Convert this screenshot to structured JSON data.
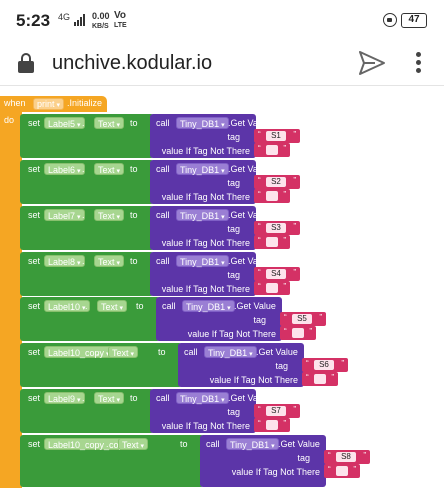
{
  "status_bar": {
    "time": "5:23",
    "signal": "4G",
    "speed_value": "0.00",
    "speed_unit": "KB/S",
    "carrier": "Vo",
    "carrier2": "LTE",
    "battery": "47"
  },
  "browser": {
    "url": "unchive.kodular.io"
  },
  "event": {
    "when_label": "when",
    "component": "print",
    "event_name": ".Initialize",
    "do_label": "do"
  },
  "blocks": [
    {
      "label": "Label5",
      "prop": "Text",
      "db": "Tiny_DB1",
      "method": ".Get Value",
      "tag": "S1"
    },
    {
      "label": "Label6",
      "prop": "Text",
      "db": "Tiny_DB1",
      "method": ".Get Value",
      "tag": "S2"
    },
    {
      "label": "Label7",
      "prop": "Text",
      "db": "Tiny_DB1",
      "method": ".Get Value",
      "tag": "S3"
    },
    {
      "label": "Label8",
      "prop": "Text",
      "db": "Tiny_DB1",
      "method": ".Get Value",
      "tag": "S4"
    },
    {
      "label": "Label10",
      "prop": "Text",
      "db": "Tiny_DB1",
      "method": ".Get Value",
      "tag": "S5"
    },
    {
      "label": "Label10_copy",
      "prop": "Text",
      "db": "Tiny_DB1",
      "method": ".Get Value",
      "tag": "S6"
    },
    {
      "label": "Label9",
      "prop": "Text",
      "db": "Tiny_DB1",
      "method": ".Get Value",
      "tag": "S7"
    },
    {
      "label": "Label10_copy_copy",
      "prop": "Text",
      "db": "Tiny_DB1",
      "method": ".Get Value",
      "tag": "S8"
    }
  ],
  "keywords": {
    "set": "set",
    "dot": ".",
    "to": "to",
    "call": "call",
    "tag": "tag",
    "value_if_not_there": "value If Tag Not There"
  }
}
